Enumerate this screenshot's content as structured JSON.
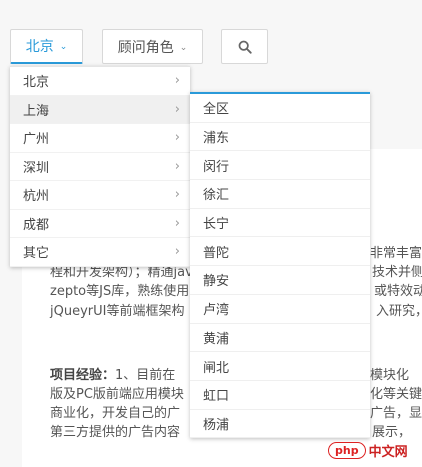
{
  "filters": {
    "city_label": "北京",
    "role_label": "顾问角色"
  },
  "city_menu": {
    "items": [
      {
        "label": "北京"
      },
      {
        "label": "上海"
      },
      {
        "label": "广州"
      },
      {
        "label": "深圳"
      },
      {
        "label": "杭州"
      },
      {
        "label": "成都"
      },
      {
        "label": "其它"
      }
    ],
    "active_index": 1
  },
  "district_menu": {
    "items": [
      "全区",
      "浦东",
      "闵行",
      "徐汇",
      "长宁",
      "普陀",
      "静安",
      "卢湾",
      "黄浦",
      "闸北",
      "虹口",
      "杨浦"
    ]
  },
  "content": {
    "line1_right": "非常丰富",
    "line2_left": "程和开发架构）；精通jav",
    "line2_right": "技术并侧",
    "line3_left": "zepto等JS库，熟练使用",
    "line3_right": "或特效动画",
    "line4_left": "jQueyrUI等前端框架构",
    "line4_right": "入研究，",
    "line5_bold": "项目经验：",
    "line5_left": "1、目前在",
    "line5_right": "模块化",
    "line6_left": "版及PC版前端应用模块",
    "line6_right": "化等关键",
    "line7_left": "商业化，开发自己的广",
    "line7_right": "广告，显",
    "line8_left": "第三方提供的广告内容",
    "line8_right": "展示，"
  },
  "watermark": {
    "badge": "php",
    "text": "中文网"
  },
  "colors": {
    "accent": "#2a9ad9"
  }
}
